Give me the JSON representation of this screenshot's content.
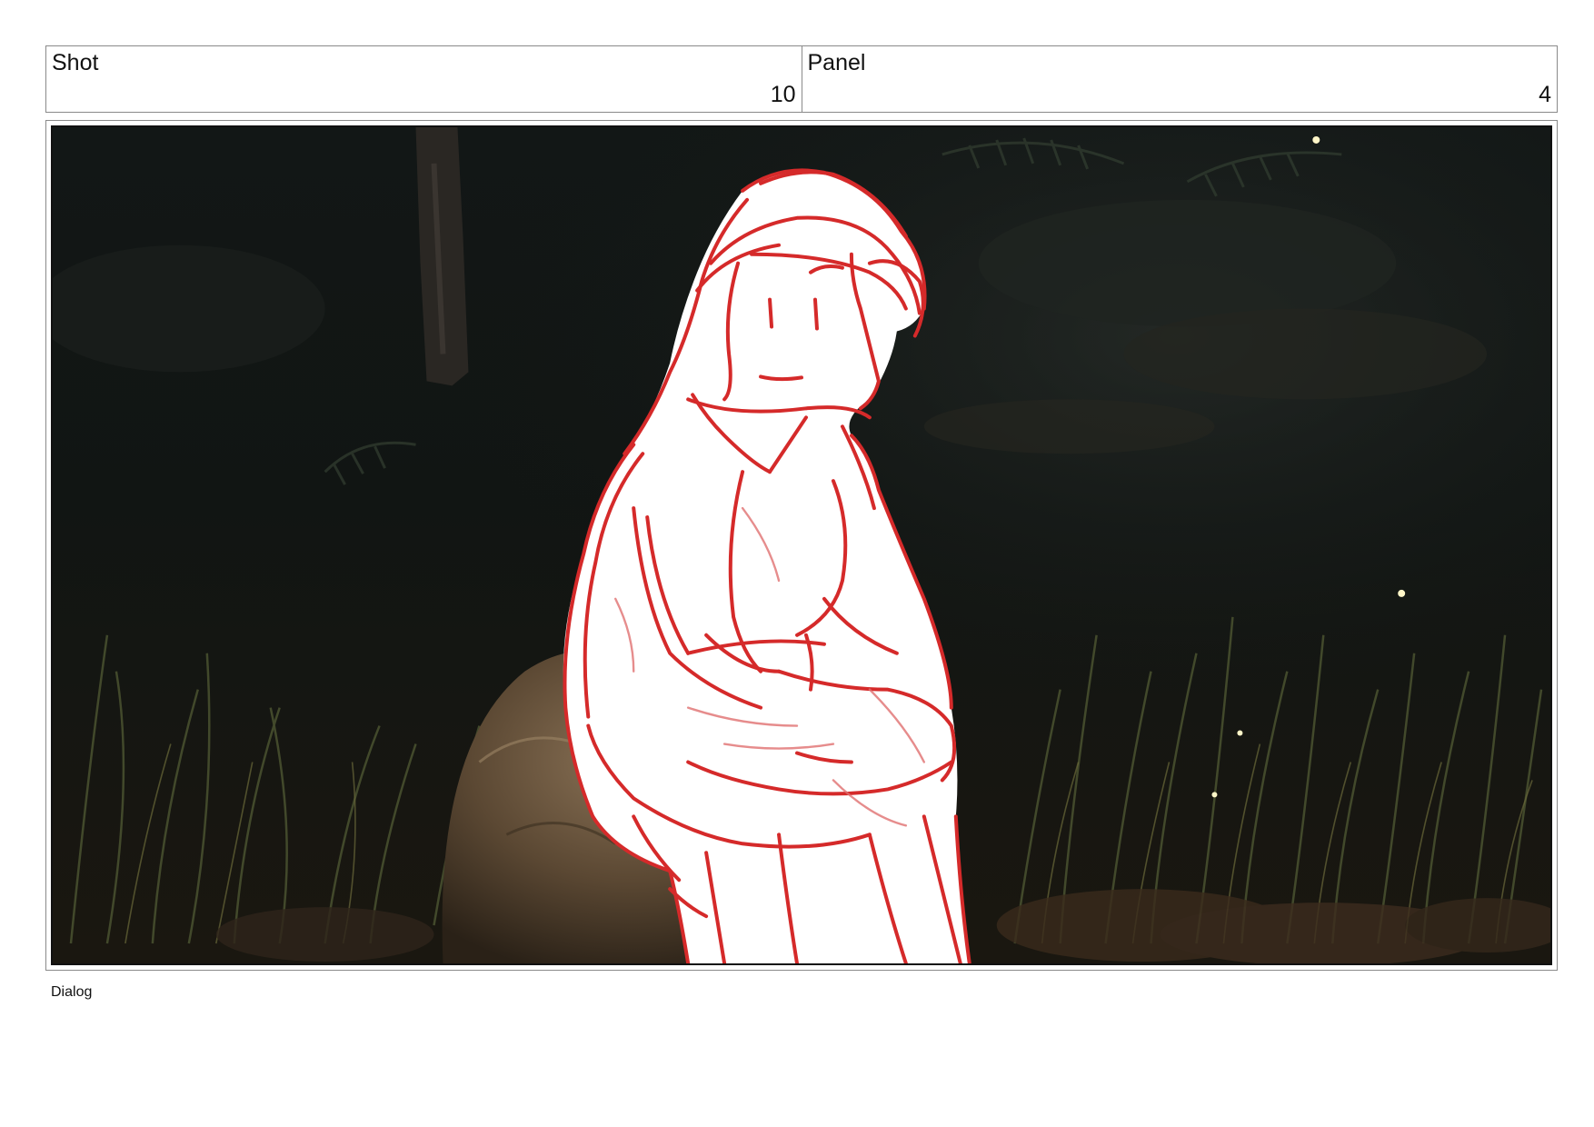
{
  "header": {
    "shot": {
      "label": "Shot",
      "value": "10"
    },
    "panel": {
      "label": "Panel",
      "value": "4"
    }
  },
  "frame": {
    "content": "storyboard-sketch",
    "sketch_color": "#d52a2a",
    "fill_color": "#ffffff",
    "background_color": "#0e1211"
  },
  "footer": {
    "dialog_label": "Dialog"
  }
}
